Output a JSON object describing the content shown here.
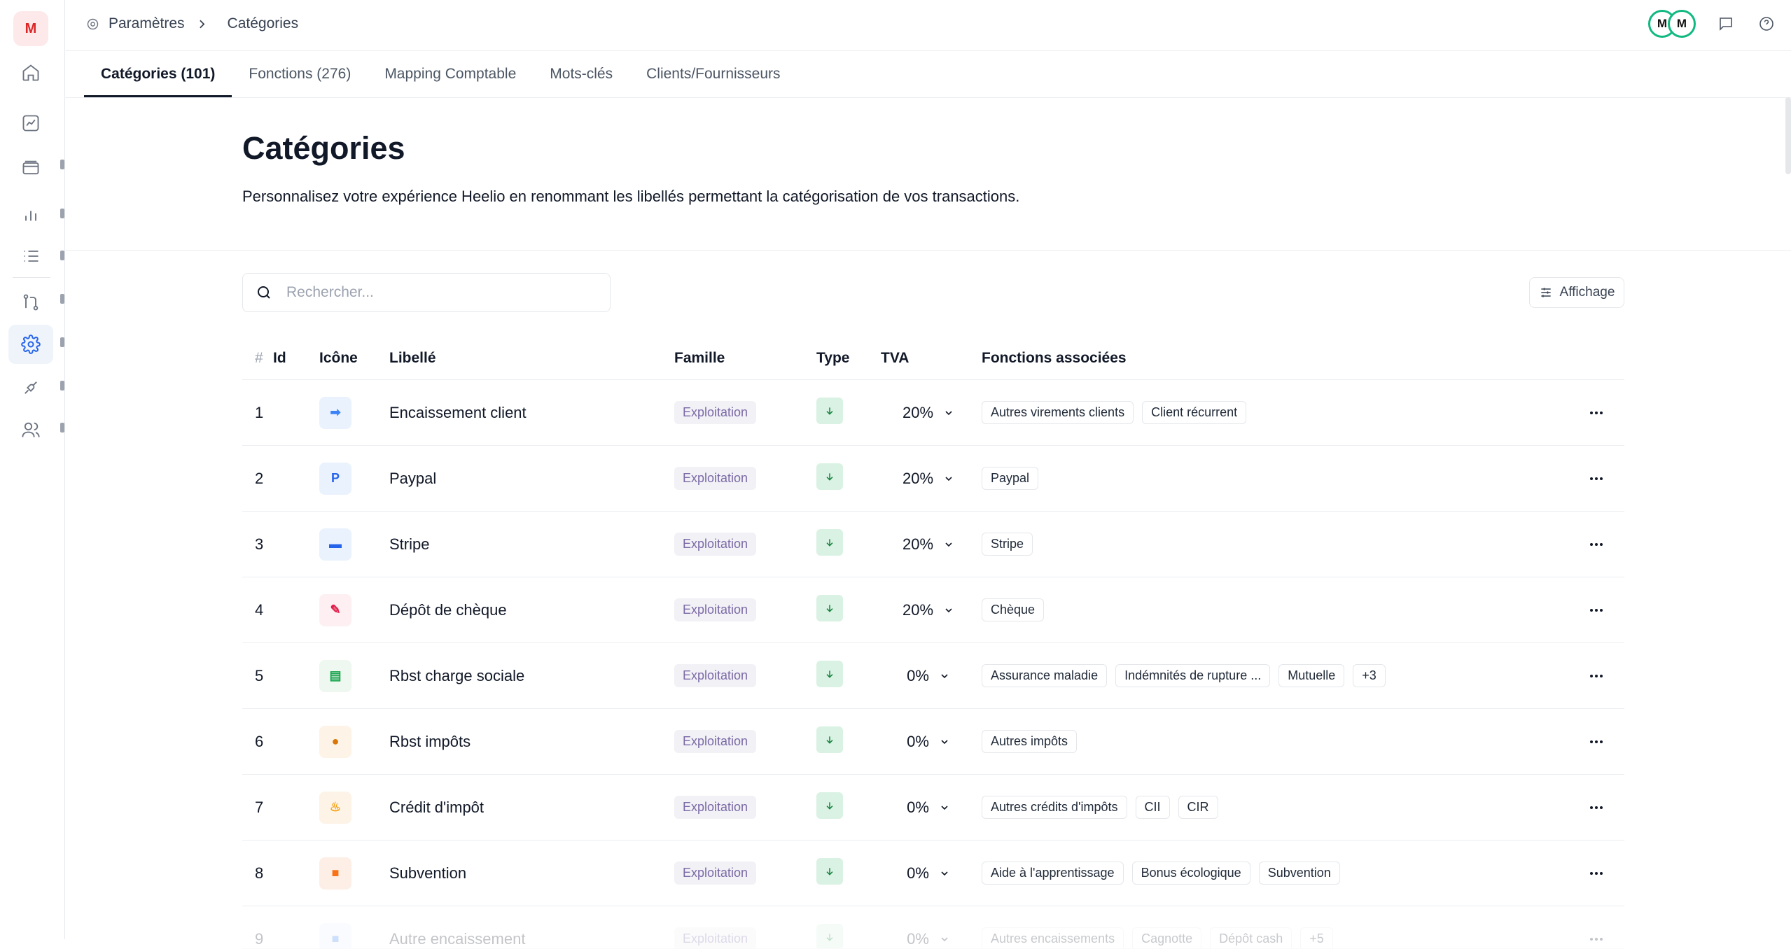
{
  "app": {
    "logo": "M"
  },
  "breadcrumb": {
    "parent": "Paramètres",
    "current": "Catégories"
  },
  "header": {
    "avatars": [
      "M",
      "M"
    ]
  },
  "tabs": [
    {
      "label": "Catégories (101)",
      "active": true
    },
    {
      "label": "Fonctions (276)",
      "active": false
    },
    {
      "label": "Mapping Comptable",
      "active": false
    },
    {
      "label": "Mots-clés",
      "active": false
    },
    {
      "label": "Clients/Fournisseurs",
      "active": false
    }
  ],
  "page": {
    "title": "Catégories",
    "description": "Personnalisez votre expérience Heelio en renommant les libellés permettant la catégorisation de vos transactions."
  },
  "search": {
    "placeholder": "Rechercher..."
  },
  "display_button": "Affichage",
  "table": {
    "columns": {
      "hash": "#",
      "id": "Id",
      "icon": "Icône",
      "label": "Libellé",
      "family": "Famille",
      "type": "Type",
      "vat": "TVA",
      "functions": "Fonctions associées"
    },
    "rows": [
      {
        "id": "1",
        "icon": "arrow-right-emoji",
        "label": "Encaissement client",
        "family": "Exploitation",
        "vat": "20%",
        "functions": [
          "Autres virements clients",
          "Client récurrent"
        ]
      },
      {
        "id": "2",
        "icon": "parking-p-emoji",
        "label": "Paypal",
        "family": "Exploitation",
        "vat": "20%",
        "functions": [
          "Paypal"
        ]
      },
      {
        "id": "3",
        "icon": "credit-card-emoji",
        "label": "Stripe",
        "family": "Exploitation",
        "vat": "20%",
        "functions": [
          "Stripe"
        ]
      },
      {
        "id": "4",
        "icon": "cheque-emoji",
        "label": "Dépôt de chèque",
        "family": "Exploitation",
        "vat": "20%",
        "functions": [
          "Chèque"
        ]
      },
      {
        "id": "5",
        "icon": "books-emoji",
        "label": "Rbst charge sociale",
        "family": "Exploitation",
        "vat": "0%",
        "functions": [
          "Assurance maladie",
          "Indémnités de rupture ...",
          "Mutuelle",
          "+3"
        ]
      },
      {
        "id": "6",
        "icon": "money-bag-emoji",
        "label": "Rbst impôts",
        "family": "Exploitation",
        "vat": "0%",
        "functions": [
          "Autres impôts"
        ]
      },
      {
        "id": "7",
        "icon": "cake-emoji",
        "label": "Crédit d'impôt",
        "family": "Exploitation",
        "vat": "0%",
        "functions": [
          "Autres crédits d'impôts",
          "CII",
          "CIR"
        ]
      },
      {
        "id": "8",
        "icon": "gift-emoji",
        "label": "Subvention",
        "family": "Exploitation",
        "vat": "0%",
        "functions": [
          "Aide à l'apprentissage",
          "Bonus écologique",
          "Subvention"
        ]
      },
      {
        "id": "9",
        "icon": "blue-square-emoji",
        "label": "Autre encaissement",
        "family": "Exploitation",
        "vat": "0%",
        "functions": [
          "Autres encaissements",
          "Cagnotte",
          "Dépôt cash",
          "+5"
        ]
      }
    ]
  },
  "colors": {
    "accent": "#2563eb",
    "avatar_ring": "#10b981",
    "type_in": "#d9f2e3",
    "family_text": "#7c6aa6",
    "logo_bg": "#fde8ea",
    "logo_text": "#dc2626"
  }
}
